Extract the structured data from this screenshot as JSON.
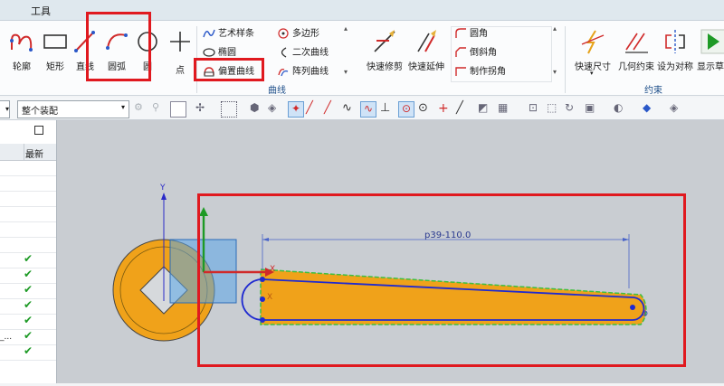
{
  "title_bar": {
    "menu_label": "工具"
  },
  "ribbon": {
    "curve_tools": {
      "profile": "轮廓",
      "rectangle": "矩形",
      "line": "直线",
      "arc": "圆弧",
      "circle": "圆",
      "point": "点"
    },
    "curve_commands": {
      "studio_spline": "艺术样条",
      "polygon": "多边形",
      "ellipse": "椭圆",
      "conic": "二次曲线",
      "offset_curve": "偏置曲线",
      "pattern_curve": "阵列曲线"
    },
    "edit_tools": {
      "quick_trim": "快速修剪",
      "quick_extend": "快速延伸",
      "fillet": "圆角",
      "chamfer": "倒斜角",
      "make_corner": "制作拐角"
    },
    "group_label_curve": "曲线",
    "constraint_tools": {
      "rapid_dimension": "快速尺寸",
      "geometric_constraints": "几何约束",
      "make_symmetric": "设为对称",
      "display_sketch": "显示草图"
    },
    "group_label_constraint": "约束"
  },
  "toolbar": {
    "assembly_filter": "整个装配"
  },
  "left_panel": {
    "column_header": "最新",
    "checked_rows": 7,
    "row_fragment": "_..."
  },
  "canvas": {
    "dimension_label": "p39-110.0",
    "axis_y": "Y",
    "axis_x": "X",
    "sketch_axis_x": "X"
  },
  "colors": {
    "accent_red": "#e0191f",
    "part_orange": "#f0a21a",
    "sketch_blue": "#1f2ad0",
    "constraint_green": "#3fbf3f"
  }
}
